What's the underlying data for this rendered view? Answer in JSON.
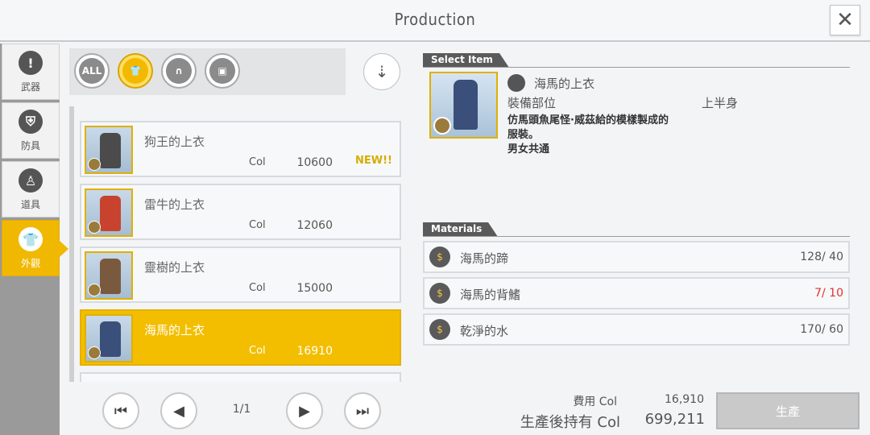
{
  "header": {
    "title": "Production",
    "close_label": "✕"
  },
  "sidebar": {
    "items": [
      {
        "label": "武器",
        "icon": "sword-icon",
        "glyph": "!"
      },
      {
        "label": "防具",
        "icon": "armor-icon",
        "glyph": "⛨"
      },
      {
        "label": "道具",
        "icon": "potion-icon",
        "glyph": "♙"
      },
      {
        "label": "外觀",
        "icon": "shirt-icon",
        "glyph": "👕"
      }
    ]
  },
  "filters": [
    {
      "label": "ALL",
      "icon": "all-filter-icon"
    },
    {
      "label": "👕",
      "icon": "top-filter-icon"
    },
    {
      "label": "∩",
      "icon": "bottom-filter-icon"
    },
    {
      "label": "▣",
      "icon": "outfit-filter-icon"
    }
  ],
  "sort_glyph": "⇣",
  "items": [
    {
      "name": "狗王的上衣",
      "col_label": "Col",
      "price": "10600",
      "badge": "NEW!!"
    },
    {
      "name": "雷牛的上衣",
      "col_label": "Col",
      "price": "12060",
      "badge": ""
    },
    {
      "name": "靈樹的上衣",
      "col_label": "Col",
      "price": "15000",
      "badge": ""
    },
    {
      "name": "海馬的上衣",
      "col_label": "Col",
      "price": "16910",
      "badge": ""
    }
  ],
  "pager": {
    "first": "⏮",
    "prev": "◀",
    "page": "1/1",
    "next": "▶",
    "last": "⏭"
  },
  "select_item": {
    "section_label": "Select Item",
    "name": "海馬的上衣",
    "slot_label": "裝備部位",
    "slot_value": "上半身",
    "description": "仿馬頭魚尾怪·威茲給的模樣製成的服裝。",
    "gender_note": "男女共通"
  },
  "materials": {
    "section_label": "Materials",
    "items": [
      {
        "name": "海馬的蹄",
        "have": "128",
        "need": "40",
        "lacking": false
      },
      {
        "name": "海馬的背鰭",
        "have": "7",
        "need": "10",
        "lacking": true
      },
      {
        "name": "乾淨的水",
        "have": "170",
        "need": "60",
        "lacking": false
      }
    ]
  },
  "cost": {
    "cost_label": "費用 Col",
    "cost_value": "16,910",
    "hold_label": "生產後持有 Col",
    "hold_value": "699,211"
  },
  "produce_button": "生產",
  "colors": {
    "accent": "#f3be00",
    "lacking": "#e23030",
    "sidebar": "#9a9a9a"
  }
}
